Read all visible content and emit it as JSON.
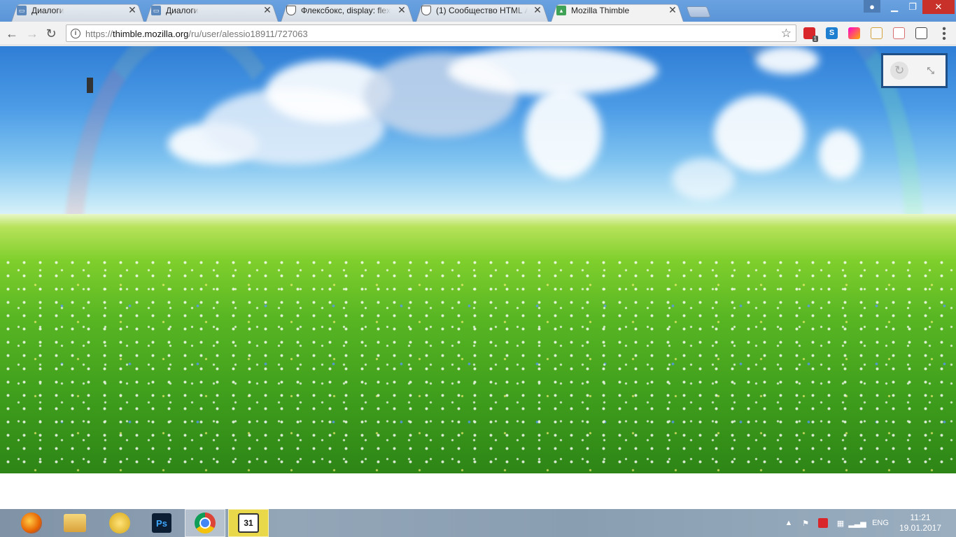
{
  "browser": {
    "tabs": [
      {
        "title": "Диалоги",
        "favicon": "vk-icon"
      },
      {
        "title": "Диалоги",
        "favicon": "vk-icon"
      },
      {
        "title": "Флексбокс, display: flex",
        "favicon": "shield-icon"
      },
      {
        "title": "(1) Сообщество HTML А",
        "favicon": "shield-icon"
      },
      {
        "title": "Mozilla Thimble",
        "favicon": "thimble-icon",
        "active": true
      }
    ],
    "close_glyph": "✕",
    "url_prefix": "https://",
    "url_host": "thimble.mozilla.org",
    "url_path": "/ru/user/alessio18911/727063",
    "extension_badge": "1"
  },
  "taskbar": {
    "apps": [
      "firefox-icon",
      "file-explorer-icon",
      "sun-app-icon",
      "photoshop-icon",
      "chrome-icon",
      "calendar-app-icon"
    ],
    "photoshop_label": "Ps",
    "calendar_label": "31",
    "language": "ENG",
    "time": "11:21",
    "date": "19.01.2017"
  },
  "colors": {
    "tabstrip": "#5b95d8",
    "window_close": "#c7312a",
    "preview_frame": "#1e4f86",
    "sky": "#4b9be6",
    "grass": "#58b623"
  }
}
